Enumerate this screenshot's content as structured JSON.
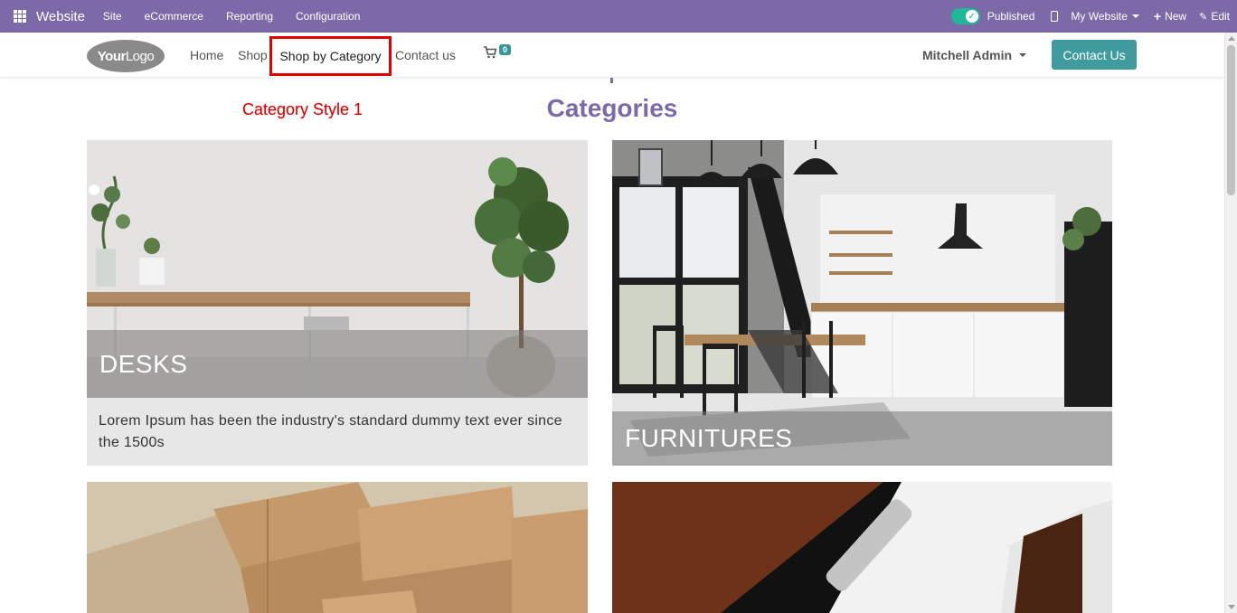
{
  "topbar": {
    "brand": "Website",
    "menu": [
      "Site",
      "eCommerce",
      "Reporting",
      "Configuration"
    ],
    "published_label": "Published",
    "my_website_label": "My Website",
    "new_label": "New",
    "edit_label": "Edit"
  },
  "header": {
    "logo_bold": "Your",
    "logo_thin": "Logo",
    "nav": {
      "home": "Home",
      "shop": "Shop",
      "shop_by_category": "Shop by Category",
      "contact": "Contact us"
    },
    "cart_count": "0",
    "user_name": "Mitchell Admin",
    "contact_button": "Contact Us"
  },
  "content": {
    "style_label": "Category Style 1",
    "section_title": "Categories",
    "categories": [
      {
        "name": "DESKS",
        "description": "Lorem Ipsum has been the industry's standard dummy text ever since the 1500s"
      },
      {
        "name": "FURNITURES"
      }
    ]
  },
  "colors": {
    "topbar": "#7c6aa8",
    "accent_teal": "#3f9b9e",
    "highlight_red": "#e00000",
    "title_purple": "#7c6aa8"
  }
}
